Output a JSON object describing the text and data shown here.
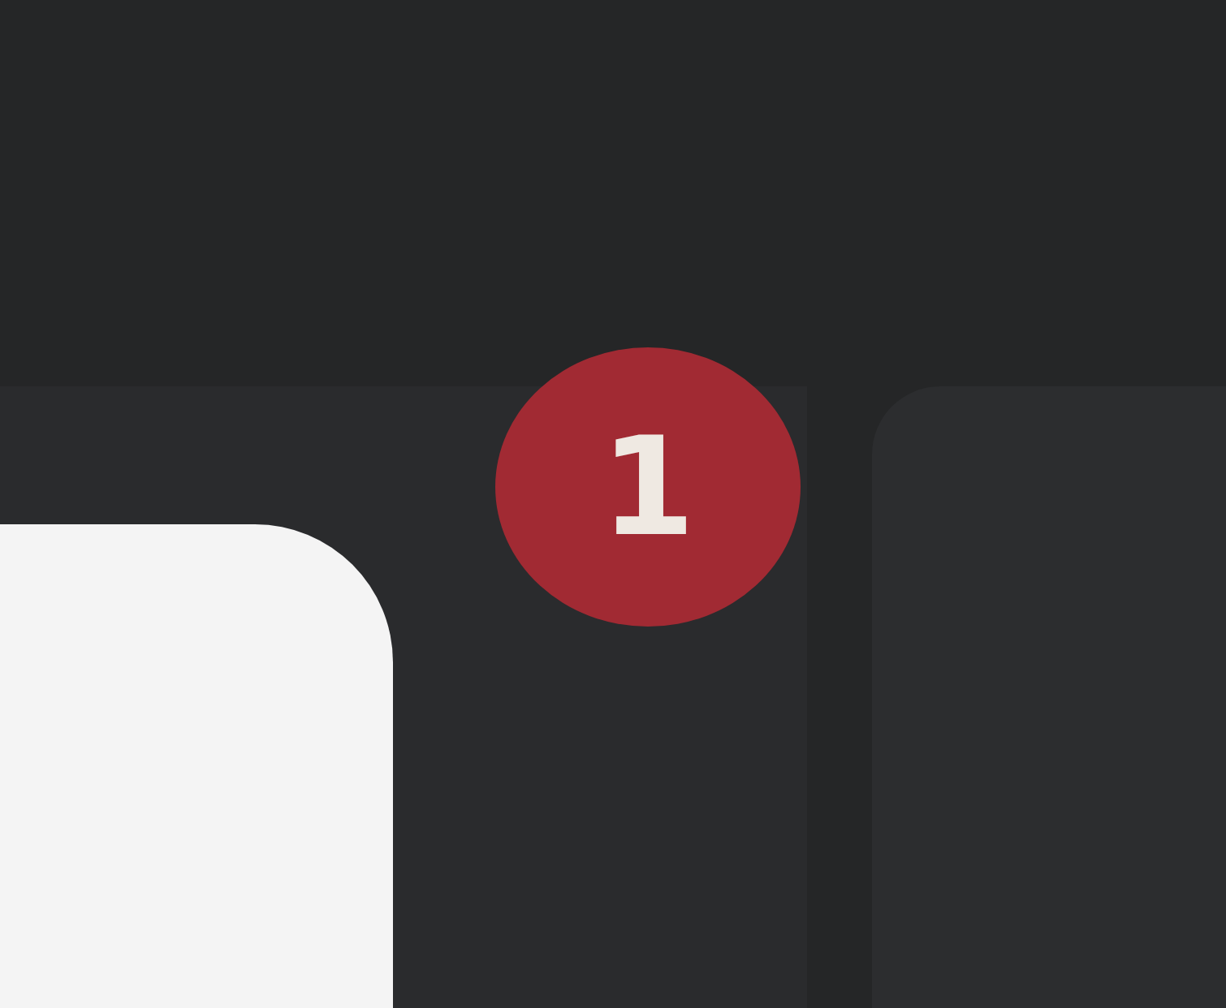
{
  "notification_badge": {
    "count": "1"
  }
}
